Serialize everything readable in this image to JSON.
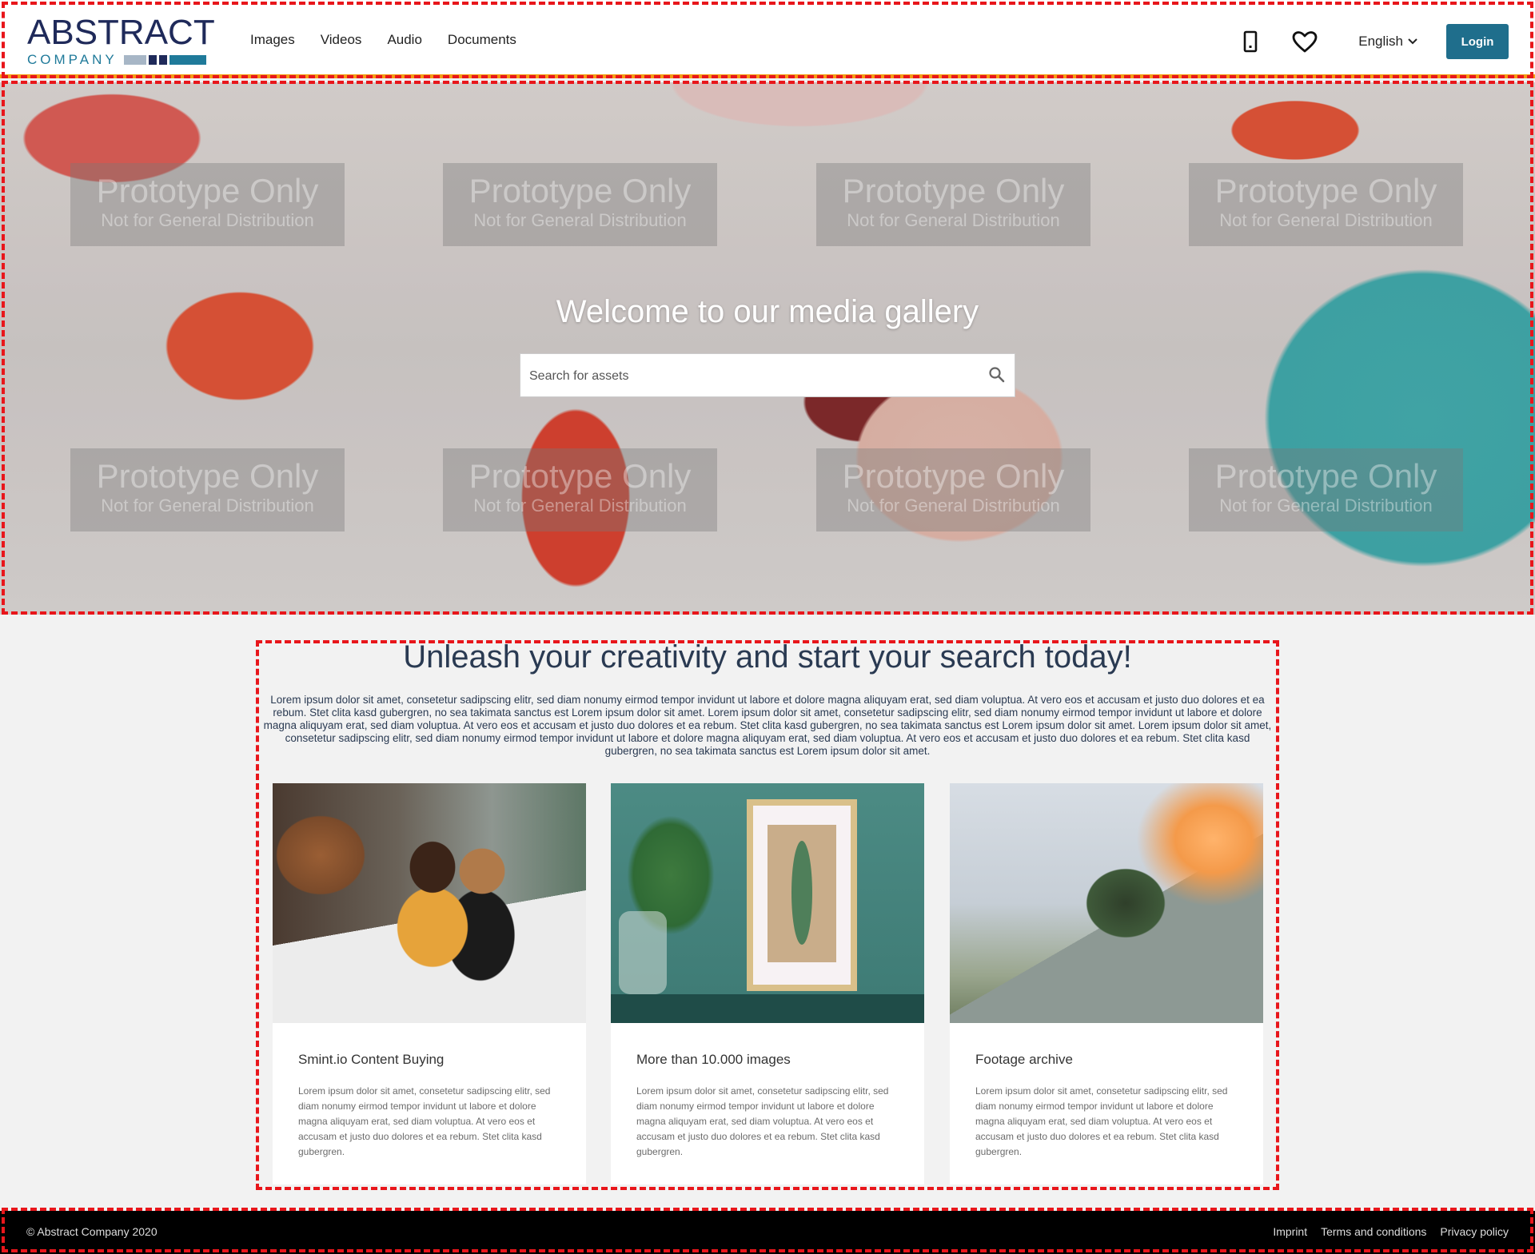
{
  "logo": {
    "top_text": "ABSTRACT",
    "bottom_text": "COMPANY",
    "colors": [
      "#1f2a5a",
      "#1f7a9a",
      "#a7b6c6"
    ]
  },
  "nav": {
    "items": [
      {
        "label": "Images"
      },
      {
        "label": "Videos"
      },
      {
        "label": "Audio"
      },
      {
        "label": "Documents"
      }
    ]
  },
  "header": {
    "device_icon": "mobile-device-icon",
    "favorites_icon": "heart-icon",
    "language": "English",
    "login_label": "Login",
    "accent_color": "#1f6e8c",
    "border_color": "#f39c12"
  },
  "hero": {
    "title": "Welcome to our media gallery",
    "search_placeholder": "Search for assets",
    "watermark_line1": "Prototype Only",
    "watermark_line2": "Not for General Distribution"
  },
  "intro": {
    "title": "Unleash your creativity and start your search today!",
    "text": "Lorem ipsum dolor sit amet, consetetur sadipscing elitr, sed diam nonumy eirmod tempor invidunt ut labore et dolore magna aliquyam erat, sed diam voluptua. At vero eos et accusam et justo duo dolores et ea rebum. Stet clita kasd gubergren, no sea takimata sanctus est Lorem ipsum dolor sit amet. Lorem ipsum dolor sit amet, consetetur sadipscing elitr, sed diam nonumy eirmod tempor invidunt ut labore et dolore magna aliquyam erat, sed diam voluptua. At vero eos et accusam et justo duo dolores et ea rebum. Stet clita kasd gubergren, no sea takimata sanctus est Lorem ipsum dolor sit amet. Lorem ipsum dolor sit amet, consetetur sadipscing elitr, sed diam nonumy eirmod tempor invidunt ut labore et dolore magna aliquyam erat, sed diam voluptua. At vero eos et accusam et justo duo dolores et ea rebum. Stet clita kasd gubergren, no sea takimata sanctus est Lorem ipsum dolor sit amet."
  },
  "cards": [
    {
      "title": "Smint.io Content Buying",
      "text": "Lorem ipsum dolor sit amet, consetetur sadipscing elitr, sed diam nonumy eirmod tempor invidunt ut labore et dolore magna aliquyam erat, sed diam voluptua. At vero eos et accusam et justo duo dolores et ea rebum. Stet clita kasd gubergren."
    },
    {
      "title": "More than 10.000 images",
      "text": "Lorem ipsum dolor sit amet, consetetur sadipscing elitr, sed diam nonumy eirmod tempor invidunt ut labore et dolore magna aliquyam erat, sed diam voluptua. At vero eos et accusam et justo duo dolores et ea rebum. Stet clita kasd gubergren."
    },
    {
      "title": "Footage archive",
      "text": "Lorem ipsum dolor sit amet, consetetur sadipscing elitr, sed diam nonumy eirmod tempor invidunt ut labore et dolore magna aliquyam erat, sed diam voluptua. At vero eos et accusam et justo duo dolores et ea rebum. Stet clita kasd gubergren."
    }
  ],
  "footer": {
    "copyright": "© Abstract Company 2020",
    "links": [
      {
        "label": "Imprint"
      },
      {
        "label": "Terms and conditions"
      },
      {
        "label": "Privacy policy"
      }
    ]
  },
  "highlight_color": "#e8161b"
}
